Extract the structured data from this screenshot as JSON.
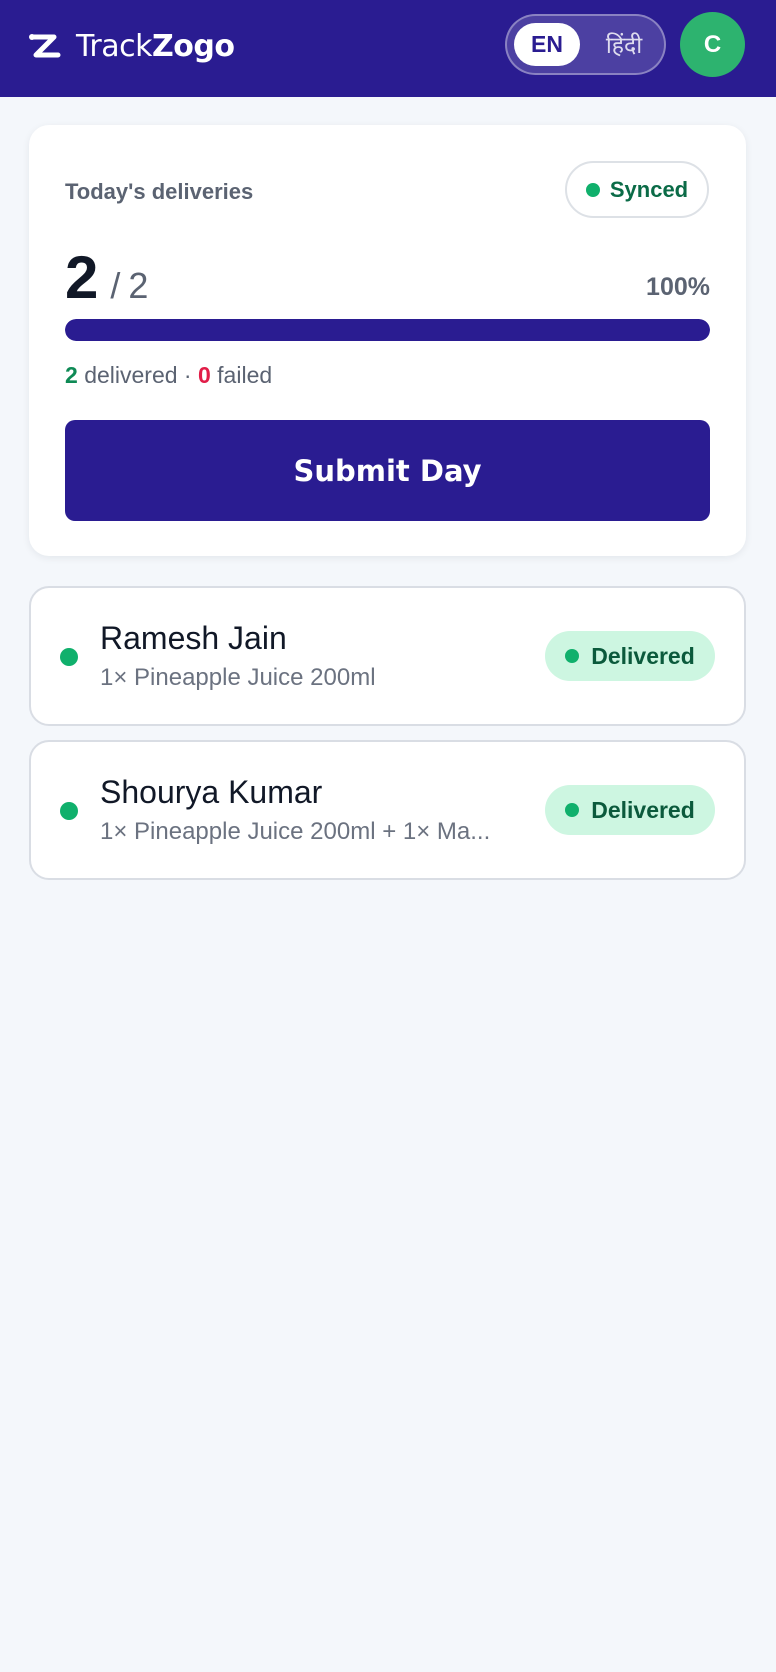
{
  "header": {
    "brand_prefix": "Track",
    "brand_suffix": "Zogo",
    "lang_en": "EN",
    "lang_hi": "हिंदी",
    "avatar_initial": "C",
    "active_language": "EN",
    "colors": {
      "header_bg": "#2a1c91",
      "avatar_bg": "#2db36f"
    }
  },
  "summary": {
    "title": "Today's deliveries",
    "sync_label": "Synced",
    "done": "2",
    "separator": "/",
    "total": "2",
    "percent_text": "100%",
    "progress_fraction": 1.0,
    "delivered_count": "2",
    "delivered_label": "delivered",
    "stats_separator": "·",
    "failed_count": "0",
    "failed_label": "failed",
    "submit_label": "Submit Day"
  },
  "deliveries": [
    {
      "name": "Ramesh Jain",
      "items": "1× Pineapple Juice 200ml",
      "status": "Delivered"
    },
    {
      "name": "Shourya Kumar",
      "items": "1× Pineapple Juice 200ml + 1× Ma...",
      "status": "Delivered"
    }
  ],
  "colors": {
    "accent": "#2a1c91",
    "success": "#10b06c",
    "danger": "#e11d48",
    "status_pill_bg": "#cdf6e1"
  }
}
